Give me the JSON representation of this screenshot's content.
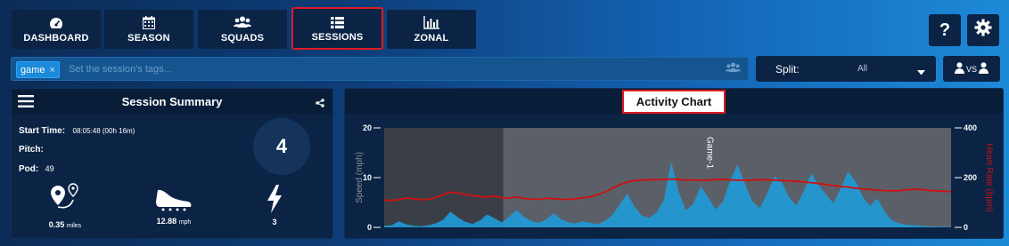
{
  "nav": {
    "tabs": [
      {
        "label": "DASHBOARD",
        "icon": "dashboard-gauge-icon"
      },
      {
        "label": "SEASON",
        "icon": "calendar-icon"
      },
      {
        "label": "SQUADS",
        "icon": "users-group-icon"
      },
      {
        "label": "SESSIONS",
        "icon": "list-icon",
        "active": true
      },
      {
        "label": "ZONAL",
        "icon": "bar-chart-icon"
      }
    ],
    "help_label": "?",
    "settings_icon": "gear-icon"
  },
  "tags": {
    "items": [
      {
        "label": "game",
        "remove": "×"
      }
    ],
    "placeholder": "Set the session's tags..."
  },
  "split": {
    "label": "Split:",
    "value": "All"
  },
  "compare": {
    "label": "VS"
  },
  "summary": {
    "title": "Session Summary",
    "start_time_label": "Start Time:",
    "start_time_value": "08:05:48 (00h 16m)",
    "pitch_label": "Pitch:",
    "pitch_value": "",
    "pod_label": "Pod:",
    "pod_value": "49",
    "count": "4",
    "distance_value": "0.35",
    "distance_unit": "miles",
    "speed_value": "12.88",
    "speed_unit": "mph",
    "sprints_value": "3"
  },
  "activity": {
    "title": "Activity Chart"
  },
  "chart_data": {
    "type": "area",
    "title": "Activity Chart",
    "ylabel": "Speed (mph)",
    "y2label": "Heart Rate (bpm)",
    "ylim": [
      0,
      20
    ],
    "y2lim": [
      0,
      400
    ],
    "yticks": [
      "0",
      "10",
      "20"
    ],
    "y2ticks": [
      "0",
      "200",
      "400"
    ],
    "annotation": "Game-1",
    "series": [
      {
        "name": "Speed (mph)",
        "values": [
          0.3,
          0.4,
          1.2,
          0.6,
          0.3,
          0.2,
          0.4,
          0.8,
          1.5,
          3.2,
          2.0,
          1.1,
          0.7,
          1.4,
          2.6,
          1.8,
          1.0,
          2.2,
          3.5,
          2.1,
          1.3,
          0.9,
          1.6,
          2.8,
          1.7,
          1.0,
          0.8,
          1.2,
          0.9,
          0.6,
          1.3,
          2.5,
          4.6,
          6.8,
          4.2,
          2.4,
          1.9,
          3.0,
          5.5,
          13.2,
          7.1,
          3.4,
          4.8,
          8.2,
          6.1,
          3.6,
          5.1,
          9.4,
          12.6,
          8.8,
          5.2,
          3.9,
          6.7,
          10.2,
          9.1,
          6.0,
          4.4,
          7.3,
          10.8,
          8.5,
          6.6,
          4.9,
          7.8,
          11.2,
          9.3,
          6.1,
          4.3,
          5.8,
          3.1,
          1.4,
          0.8,
          0.5,
          0.4,
          0.3,
          0.2,
          0.2,
          0.1,
          0.1
        ]
      },
      {
        "name": "Heart Rate (bpm)",
        "values": [
          110,
          108,
          112,
          118,
          115,
          111,
          113,
          120,
          131,
          142,
          138,
          132,
          128,
          124,
          121,
          126,
          119,
          118,
          122,
          116,
          114,
          112,
          117,
          115,
          113,
          112,
          115,
          119,
          123,
          131,
          142,
          158,
          171,
          182,
          188,
          190,
          192,
          191,
          193,
          194,
          192,
          190,
          191,
          189,
          190,
          192,
          193,
          191,
          190,
          189,
          190,
          192,
          191,
          190,
          188,
          187,
          185,
          183,
          180,
          176,
          172,
          168,
          165,
          162,
          158,
          154,
          152,
          150,
          148,
          147,
          148,
          151,
          153,
          152,
          149,
          147,
          145,
          144
        ]
      }
    ],
    "shaded_region": [
      0.21,
      1.0
    ],
    "colors": {
      "speed": "#1f9bd8",
      "heart_rate": "#d01010"
    },
    "grid": false
  }
}
